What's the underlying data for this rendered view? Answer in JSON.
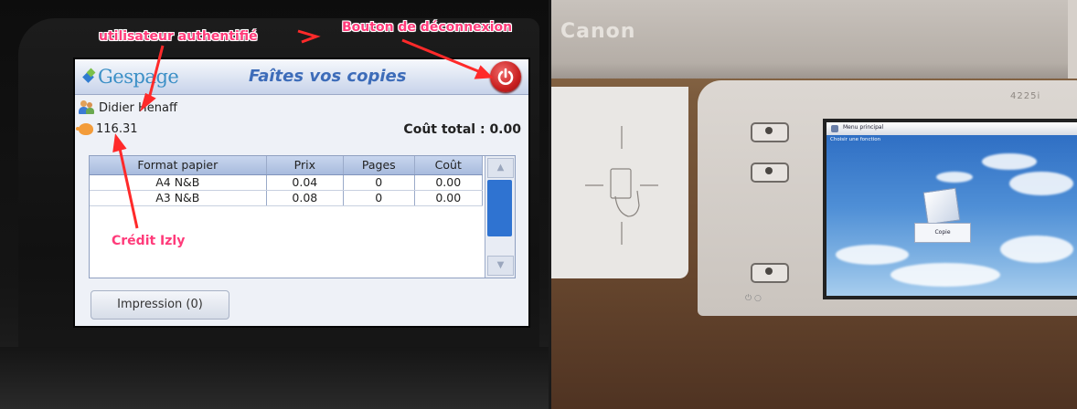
{
  "left_screen": {
    "logo_text": "Gespage",
    "title": "Faîtes vos copies",
    "user_name": "Didier Henaff",
    "credit": "116.31",
    "total_label": "Coût total : 0.00",
    "table": {
      "headers": [
        "Format papier",
        "Prix",
        "Pages",
        "Coût"
      ],
      "rows": [
        [
          "A4 N&B",
          "0.04",
          "0",
          "0.00"
        ],
        [
          "A3 N&B",
          "0.08",
          "0",
          "0.00"
        ]
      ]
    },
    "print_button": "Impression (0)",
    "colors": {
      "header_title": "#3d6cb9",
      "power_button": "#c92020",
      "scroll_thumb": "#2f73d1"
    }
  },
  "annotations": {
    "authenticated_user": "utilisateur authentifié",
    "logout_button": "Bouton de déconnexion",
    "credit": "Crédit Izly",
    "color": "#ff3b7a"
  },
  "right_photo": {
    "brand": "Canon",
    "model": "4225i",
    "screen_title": "Menu principal",
    "screen_subtitle": "Choisir une fonction",
    "copy_tile_label": "Copie"
  },
  "icons": [
    "power-icon",
    "user-icon",
    "piggy-bank-icon",
    "scroll-up-icon",
    "scroll-down-icon",
    "card-reader-icon"
  ]
}
